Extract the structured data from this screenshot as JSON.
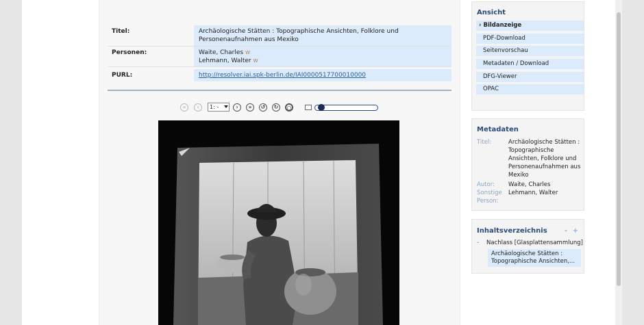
{
  "metadata_table": {
    "rows": [
      {
        "label": "Titel:",
        "value": "Archäologische Stätten : Topographische Ansichten, Folklore und Personenaufnahmen aus Mexiko"
      },
      {
        "label": "Personen:",
        "value_lines": [
          "Waite, Charles",
          "Lehmann, Walter"
        ]
      },
      {
        "label": "PURL:",
        "value": "http://resolver.iai.spk-berlin.de/IAI0000517700010000"
      }
    ],
    "person_icon": "wiki-icon"
  },
  "viewer_toolbar": {
    "page_select_value": "1: -",
    "icons": [
      "first-page-icon",
      "previous-page-icon",
      "next-page-icon",
      "last-page-icon",
      "rotate-left-icon",
      "rotate-right-icon",
      "reset-icon",
      "zoom-icon"
    ],
    "zoom_level": 0.05
  },
  "sidebar": {
    "view_panel": {
      "title": "Ansicht",
      "items": [
        {
          "label": "Bildanzeige",
          "active": true
        },
        {
          "label": "PDF-Download"
        },
        {
          "label": "Seitenvorschau"
        },
        {
          "label": "Metadaten / Download"
        },
        {
          "label": "DFG-Viewer"
        },
        {
          "label": "OPAC"
        }
      ]
    },
    "metadata_panel": {
      "title": "Metadaten",
      "title_label": "Titel:",
      "title_value": "Archäologische Stätten : Topographische Ansichten, Folklore und Personenaufnahmen aus Mexiko",
      "author_label": "Autor:",
      "author_value": "Waite, Charles",
      "other_label": "Sonstige Person:",
      "other_value": "Lehmann, Walter"
    },
    "toc_panel": {
      "title": "Inhaltsverzeichnis",
      "controls": "- +",
      "collapse_symbol": "-",
      "item": "Nachlass [Glasplattensammlung]",
      "subitem": "Archäologische Stätten : Topographische Ansichten,..."
    }
  },
  "colors": {
    "accent": "#2a4a78",
    "highlight": "#dbebfb",
    "link": "#2d5f9a"
  }
}
